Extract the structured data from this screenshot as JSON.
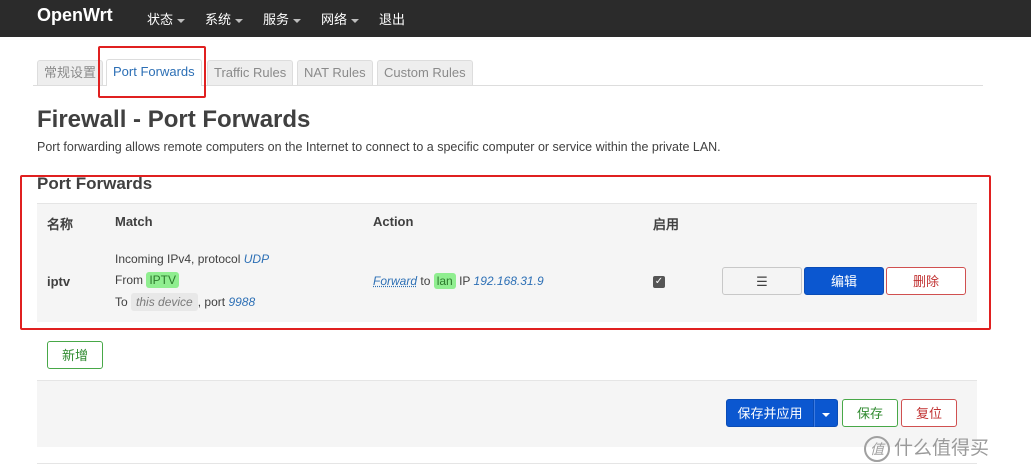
{
  "navbar": {
    "brand": "OpenWrt",
    "items": [
      {
        "label": "状态",
        "dropdown": true
      },
      {
        "label": "系统",
        "dropdown": true
      },
      {
        "label": "服务",
        "dropdown": true
      },
      {
        "label": "网络",
        "dropdown": true
      },
      {
        "label": "退出",
        "dropdown": false
      }
    ]
  },
  "tabs": [
    {
      "label": "常规设置",
      "active": false
    },
    {
      "label": "Port Forwards",
      "active": true
    },
    {
      "label": "Traffic Rules",
      "active": false
    },
    {
      "label": "NAT Rules",
      "active": false
    },
    {
      "label": "Custom Rules",
      "active": false
    }
  ],
  "page": {
    "title": "Firewall - Port Forwards",
    "description": "Port forwarding allows remote computers on the Internet to connect to a specific computer or service within the private LAN."
  },
  "section": {
    "title": "Port Forwards",
    "columns": {
      "name": "名称",
      "match": "Match",
      "action": "Action",
      "enabled": "启用"
    },
    "rows": [
      {
        "name": "iptv",
        "match": {
          "incoming": "Incoming IPv4, protocol",
          "protocol": "UDP",
          "from_label": "From",
          "from_zone": "IPTV",
          "to_label": "To",
          "to_target": "this device",
          "port_label": ", port",
          "port": "9988"
        },
        "action": {
          "verb": "Forward",
          "to_label": "to",
          "zone": "lan",
          "ip_label": "IP",
          "ip": "192.168.31.9"
        },
        "enabled": true,
        "buttons": {
          "menu": "☰",
          "edit": "编辑",
          "delete": "删除"
        }
      }
    ],
    "add_button": "新增"
  },
  "footer": {
    "save_apply": "保存并应用",
    "save": "保存",
    "reset": "复位"
  },
  "watermark": {
    "logo": "值",
    "text": "什么值得买"
  },
  "colors": {
    "navbar": "#2b2b2b",
    "primary": "#0b57d0",
    "positive": "#48a848",
    "negative": "#d05050",
    "highlight": "#e02020",
    "zone": "#90ee90"
  }
}
